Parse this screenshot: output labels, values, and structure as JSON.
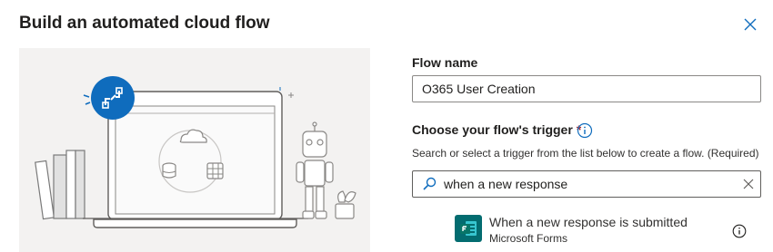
{
  "dialog": {
    "title": "Build an automated cloud flow",
    "close_icon": "close-icon"
  },
  "form": {
    "flow_name_label": "Flow name",
    "flow_name_value": "O365 User Creation",
    "trigger_label": "Choose your flow's trigger",
    "required_marker": "*",
    "trigger_hint": "Search or select a trigger from the list below to create a flow. (Required)",
    "search_value": "when a new response",
    "trigger_options": [
      {
        "title": "When a new response is submitted",
        "connector": "Microsoft Forms",
        "icon": "microsoft-forms-icon"
      }
    ]
  },
  "colors": {
    "accent": "#0f6cbd",
    "illustration_bg": "#f3f2f1",
    "forms_brand": "#036c70",
    "required": "#a4262c"
  }
}
